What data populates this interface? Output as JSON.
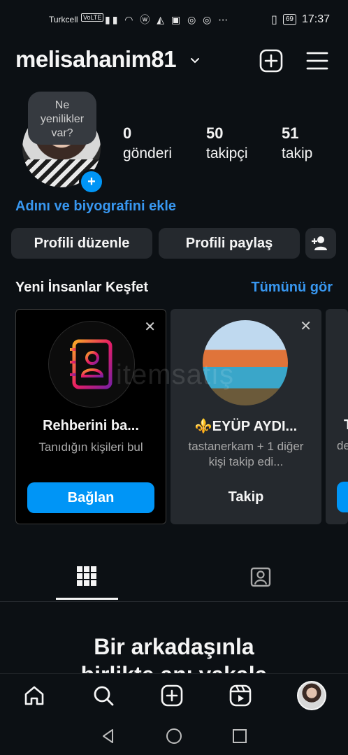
{
  "status_bar": {
    "carrier": "Turkcell",
    "volte": "VoLTE",
    "battery": "69",
    "time": "17:37"
  },
  "header": {
    "username": "melisahanim81",
    "icons": [
      "chevron-down-icon",
      "new-post-icon",
      "menu-icon"
    ]
  },
  "profile": {
    "bubble_text": [
      "Ne",
      "yenilikler",
      "var?"
    ],
    "stats": [
      {
        "value": "0",
        "label": "gönderi"
      },
      {
        "value": "50",
        "label": "takipçi"
      },
      {
        "value": "51",
        "label": "takip"
      }
    ],
    "bio_link": "Adını ve biyografini ekle"
  },
  "actions": {
    "edit_profile": "Profili düzenle",
    "share_profile": "Profili paylaş"
  },
  "discover": {
    "title": "Yeni İnsanlar Keşfet",
    "see_all": "Tümünü gör",
    "cards": [
      {
        "name": "Rehberini ba...",
        "subtitle": "Tanıdığın kişileri bul",
        "cta": "Bağlan"
      },
      {
        "name": "⚜️EYÜP AYDI...",
        "subtitle": "tastanerkam + 1 diğer kişi takip edi...",
        "cta": "Takip"
      }
    ],
    "partial_card_letters": [
      "T",
      "de"
    ]
  },
  "watermark": "itemsatış",
  "tabs": [
    "grid-icon",
    "tagged-icon"
  ],
  "empty_state": {
    "headline_line1": "Bir arkadaşınla",
    "headline_line2": "birlikte anı yakala"
  },
  "bottom_nav": [
    "home-icon",
    "search-icon",
    "create-icon",
    "reels-icon",
    "profile-avatar"
  ],
  "colors": {
    "background": "#0c1014",
    "accent_blue": "#0095f6",
    "link_blue": "#3897f0",
    "button_gray": "#25292e"
  }
}
